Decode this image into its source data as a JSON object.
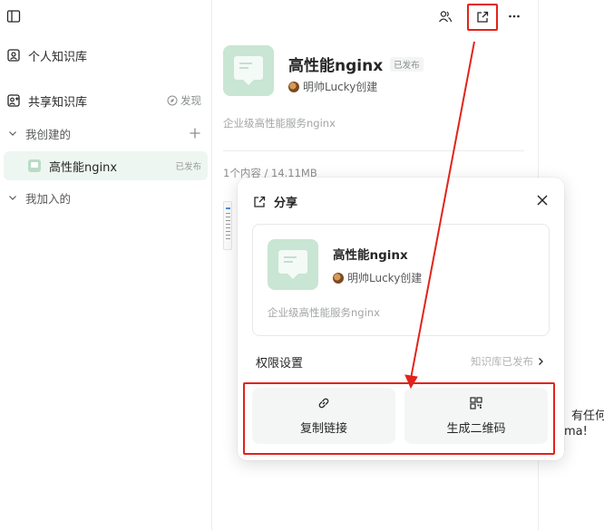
{
  "sidebar": {
    "personal_label": "个人知识库",
    "shared_label": "共享知识库",
    "discover_label": "发现",
    "created_group": "我创建的",
    "joined_group": "我加入的",
    "items": [
      {
        "label": "高性能nginx",
        "badge": "已发布"
      }
    ]
  },
  "book": {
    "title": "高性能nginx",
    "publish_badge": "已发布",
    "creator": "明帅Lucky创建",
    "description": "企业级高性能服务nginx",
    "stats": "1个内容 / 14.11MB"
  },
  "share_popup": {
    "title": "分享",
    "card_title": "高性能nginx",
    "card_creator": "明帅Lucky创建",
    "card_description": "企业级高性能服务nginx",
    "permission_label": "权限设置",
    "permission_status": "知识库已发布",
    "copy_link_label": "复制链接",
    "qr_label": "生成二维码"
  },
  "right_clip": {
    "line1": "有任何",
    "line2": "ma!"
  },
  "colors": {
    "annotation_red": "#e2231a",
    "accent_green": "#c9e5d3",
    "active_bg": "#eef6f1"
  },
  "icons": {
    "toggle": "sidebar-toggle-icon",
    "members": "members-icon",
    "share": "share-icon",
    "more": "more-icon",
    "link": "link-icon",
    "qr": "qrcode-icon"
  }
}
